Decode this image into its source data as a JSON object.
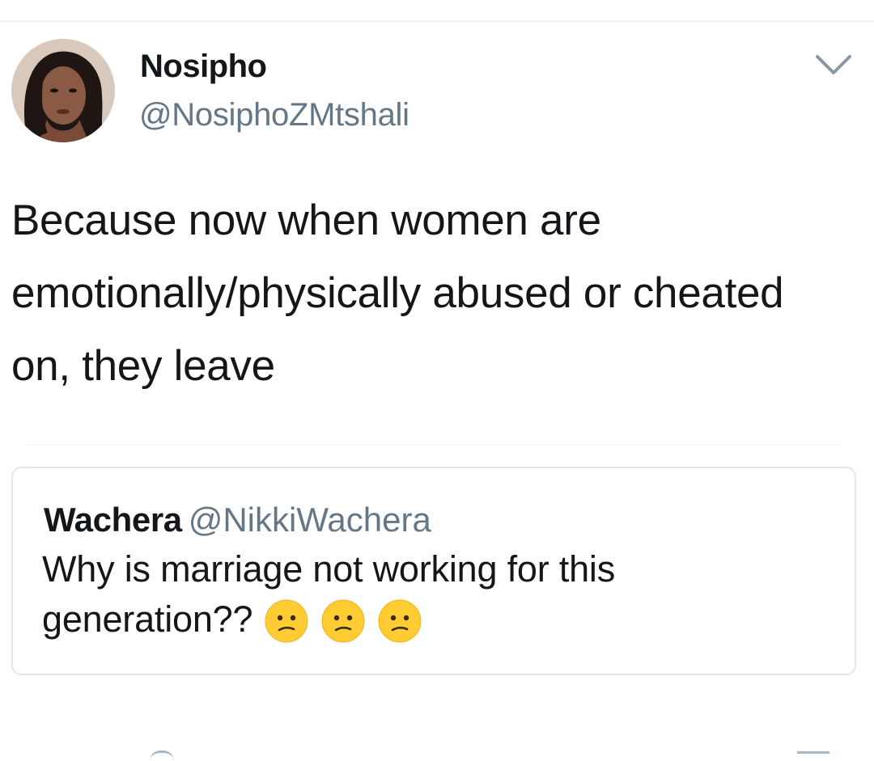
{
  "tweet": {
    "author": {
      "display_name": "Nosipho",
      "handle": "@NosiphoZMtshali",
      "avatar_icon": "profile-photo"
    },
    "menu_icon": "chevron-down-icon",
    "text": "Because now when women are emotionally/physically abused or cheated on, they leave"
  },
  "quoted_tweet": {
    "display_name": "Wachera",
    "handle": "@NikkiWachera",
    "text": "Why is marriage not working for this generation??",
    "emojis": [
      "confused-face",
      "confused-face",
      "confused-face"
    ]
  },
  "colors": {
    "text_primary": "#14171a",
    "text_secondary": "#657786",
    "card_border": "#e1e8ed",
    "emoji_yellow": "#ffcc33"
  }
}
